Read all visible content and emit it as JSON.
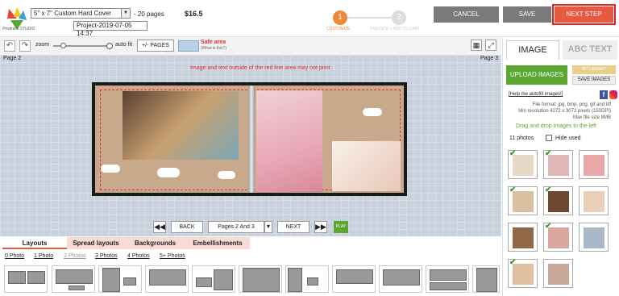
{
  "header": {
    "logo_text": "Pristine's STUDIO",
    "product": "5\" x 7\" Custom Hard Cover",
    "pages": "- 20 pages",
    "price": "$16.5",
    "project": "Project-2019-07-05 14:37",
    "steps": [
      {
        "num": "1",
        "label": "CUSTOMIZE"
      },
      {
        "num": "2",
        "label": "PREVIEW + ADD TO CART"
      }
    ],
    "cancel": "CANCEL",
    "save": "SAVE",
    "next_step": "NEXT STEP"
  },
  "toolbar": {
    "zoom": "zoom",
    "auto_fit": "auto fit",
    "pages_btn": "+/- PAGES",
    "safe_area": "Safe area",
    "safe_sub": "(What is this?)"
  },
  "canvas": {
    "page_left": "Page 2",
    "page_right": "Page 3",
    "warning": "Image and text outside of the red line area may not print"
  },
  "nav": {
    "back": "BACK",
    "pages": "Pages 2 And 3",
    "next": "NEXT",
    "play": "PLAY"
  },
  "tabs": [
    "Layouts",
    "Spread layouts",
    "Backgrounds",
    "Embellishments"
  ],
  "subtabs": [
    "0 Photo",
    "1 Photo",
    "2 Photos",
    "3 Photos",
    "4 Photos",
    "5+ Photos"
  ],
  "right": {
    "tab_image": "IMAGE",
    "tab_text": "ABC TEXT",
    "upload": "UPLOAD IMAGES",
    "my_library": "MY LIBRARY",
    "save_images": "SAVE IMAGES",
    "help": "[Help me autofill images!]",
    "info": [
      "File format: jpg, bmp, png, gif and tiff",
      "Min resolution 4272 x 3072 pixels (150DPI)",
      "Max file size 8MB"
    ],
    "drag": "Drag and drop images to the left",
    "count": "11 photos",
    "hide_used": "Hide used"
  },
  "colors": {
    "accent": "#f0883a",
    "green": "#5aa832",
    "red": "#e03030",
    "next": "#e85a40"
  }
}
